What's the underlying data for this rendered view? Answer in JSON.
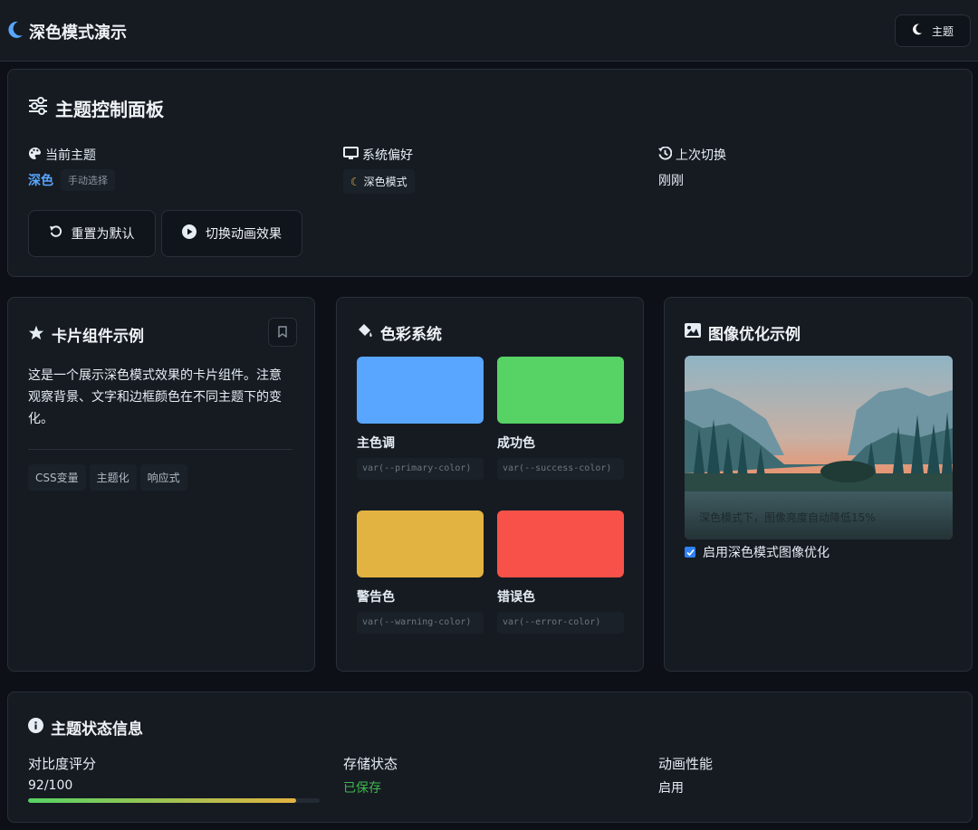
{
  "header": {
    "title": "深色模式演示",
    "theme_button_label": "主题"
  },
  "control_panel": {
    "title": "主题控制面板",
    "current_theme": {
      "label": "当前主题",
      "value": "深色",
      "badge": "手动选择"
    },
    "system_pref": {
      "label": "系统偏好",
      "value": "深色模式"
    },
    "last_switch": {
      "label": "上次切换",
      "value": "刚刚"
    },
    "buttons": {
      "reset": "重置为默认",
      "toggle_anim": "切换动画效果"
    }
  },
  "card_example": {
    "title": "卡片组件示例",
    "body": "这是一个展示深色模式效果的卡片组件。注意观察背景、文字和边框颜色在不同主题下的变化。",
    "tags": [
      "CSS变量",
      "主题化",
      "响应式"
    ]
  },
  "color_system": {
    "title": "色彩系统",
    "swatches": [
      {
        "name": "主色调",
        "code": "var(--primary-color)",
        "color": "#58a6ff"
      },
      {
        "name": "成功色",
        "code": "var(--success-color)",
        "color": "#56d364"
      },
      {
        "name": "警告色",
        "code": "var(--warning-color)",
        "color": "#e3b341"
      },
      {
        "name": "错误色",
        "code": "var(--error-color)",
        "color": "#f85149"
      }
    ]
  },
  "image_example": {
    "title": "图像优化示例",
    "caption": "深色模式下，图像亮度自动降低15%",
    "checkbox_label": "启用深色模式图像优化",
    "checked": true
  },
  "status": {
    "title": "主题状态信息",
    "contrast": {
      "label": "对比度评分",
      "value": "92/100",
      "score": 0.92
    },
    "storage": {
      "label": "存储状态",
      "value": "已保存"
    },
    "animation": {
      "label": "动画性能",
      "value": "启用"
    }
  },
  "colors": {
    "accent": "#58a6ff",
    "success": "#3fb950",
    "bg": "#0d1117",
    "card": "#161b22"
  }
}
